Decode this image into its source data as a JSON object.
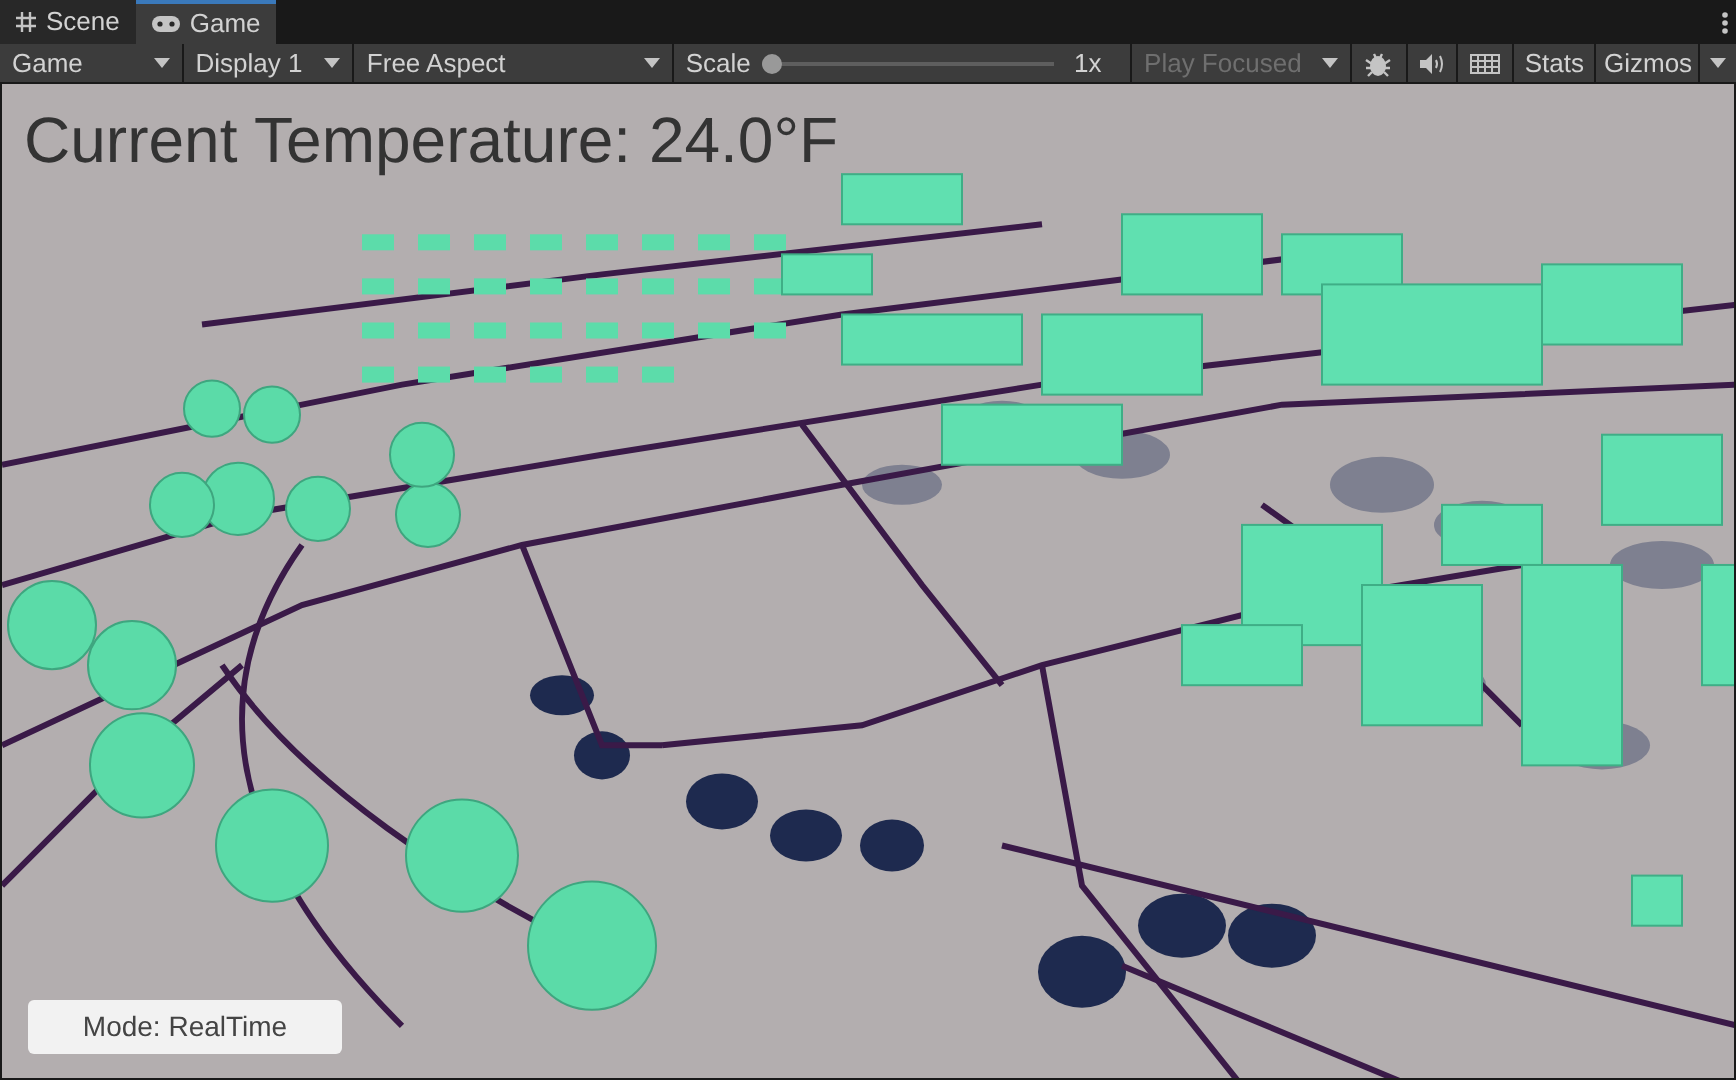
{
  "tabs": [
    {
      "label": "Scene",
      "selected": false
    },
    {
      "label": "Game",
      "selected": true
    }
  ],
  "toolbar": {
    "view_dropdown": "Game",
    "display_dropdown": "Display 1",
    "aspect_dropdown": "Free Aspect",
    "scale": {
      "label": "Scale",
      "level": 0,
      "reading": "1x"
    },
    "play_mode_dropdown": {
      "label": "Play Focused",
      "disabled": true
    },
    "stats_button": "Stats",
    "gizmos_button": "Gizmos"
  },
  "viewport": {
    "temperature_label": "Current Temperature: 24.0°F",
    "mode_button": "Mode: RealTime"
  }
}
